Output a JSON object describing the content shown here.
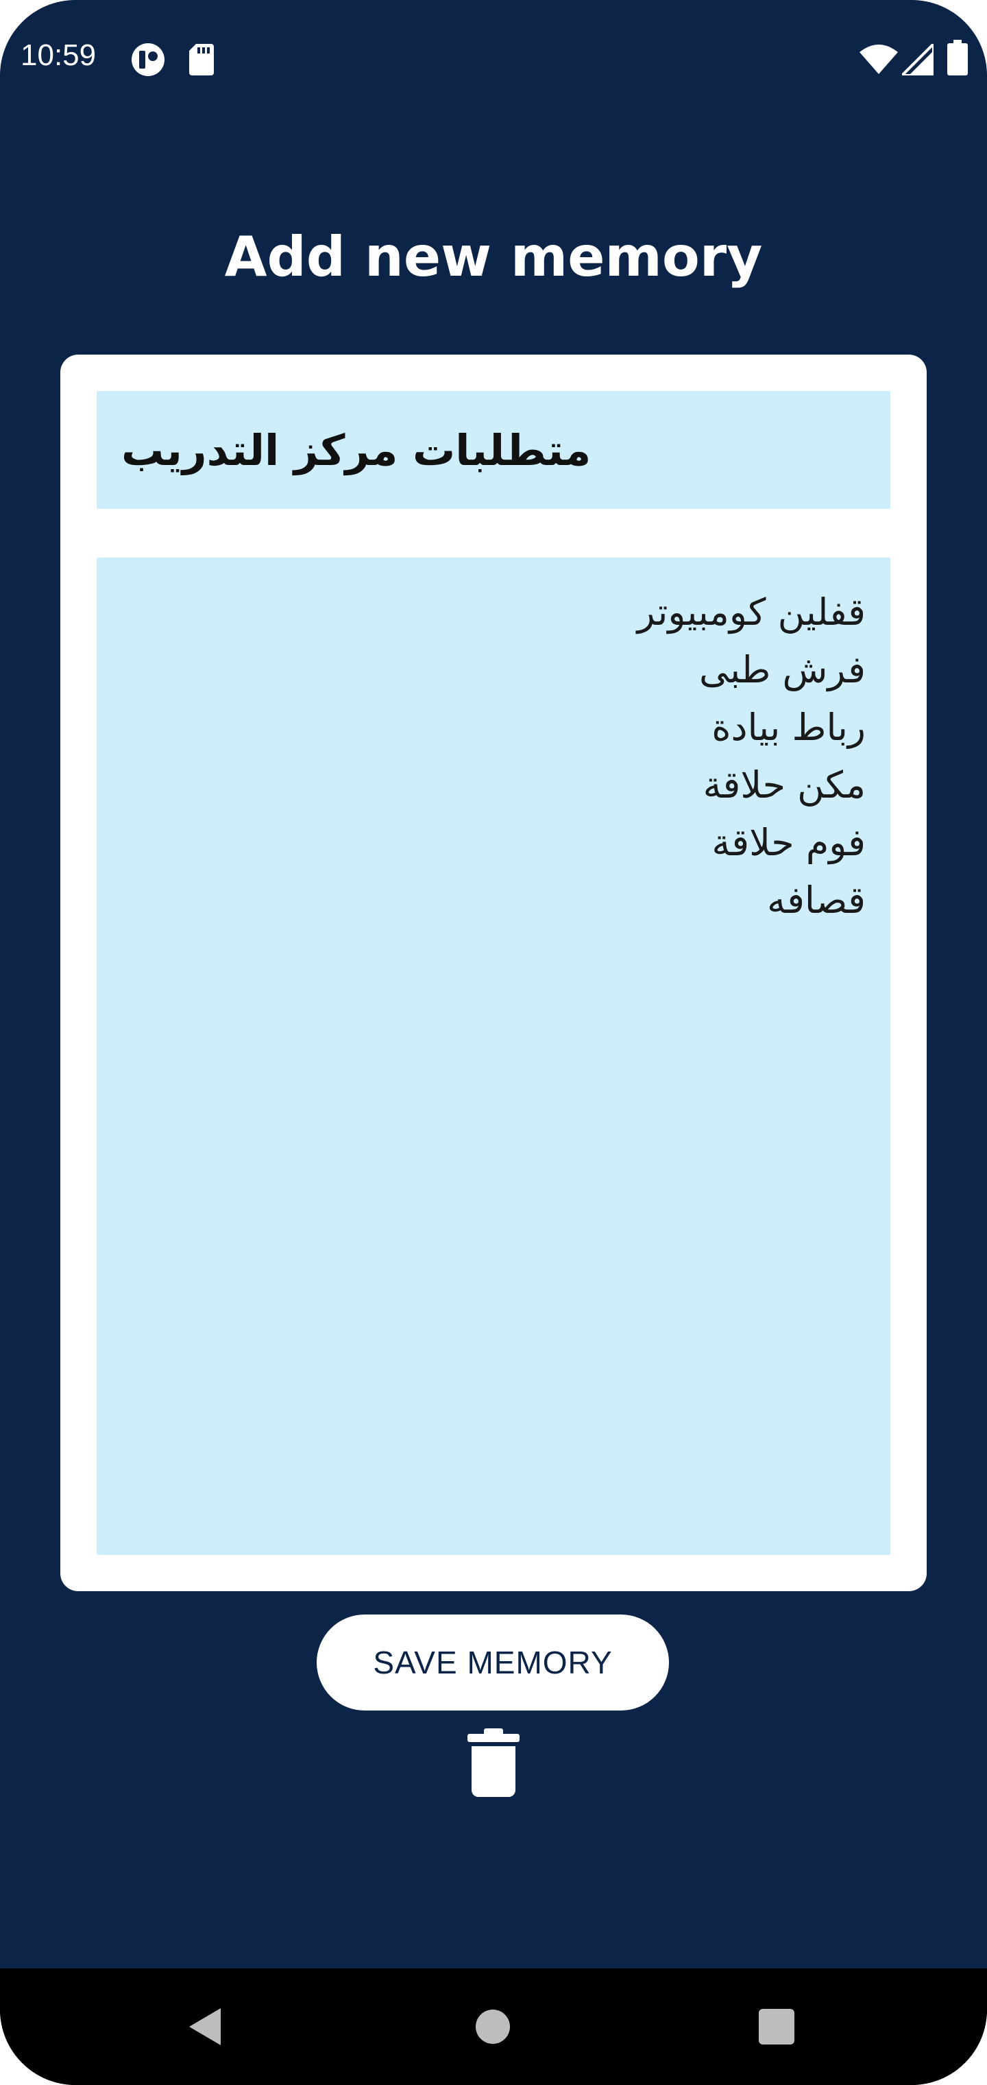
{
  "status_bar": {
    "time": "10:59",
    "left_icons": [
      "notification-app-icon",
      "sd-card-icon"
    ],
    "right_icons": [
      "wifi-icon",
      "signal-icon",
      "battery-icon"
    ]
  },
  "screen": {
    "title": "Add new memory",
    "background_color": "#0b2447"
  },
  "memory_form": {
    "title_value": "متطلبات مركز التدريب",
    "body_lines": [
      "قفلين كومبيوتر",
      "فرش طبى",
      "رباط بيادة",
      "مكن حلاقة",
      "فوم حلاقة",
      "قصافه"
    ],
    "field_color": "#cfeefc"
  },
  "actions": {
    "save_label": "SAVE MEMORY",
    "delete_icon": "trash-icon"
  },
  "nav_bar": {
    "buttons": [
      "back-icon",
      "home-icon",
      "recents-icon"
    ]
  }
}
